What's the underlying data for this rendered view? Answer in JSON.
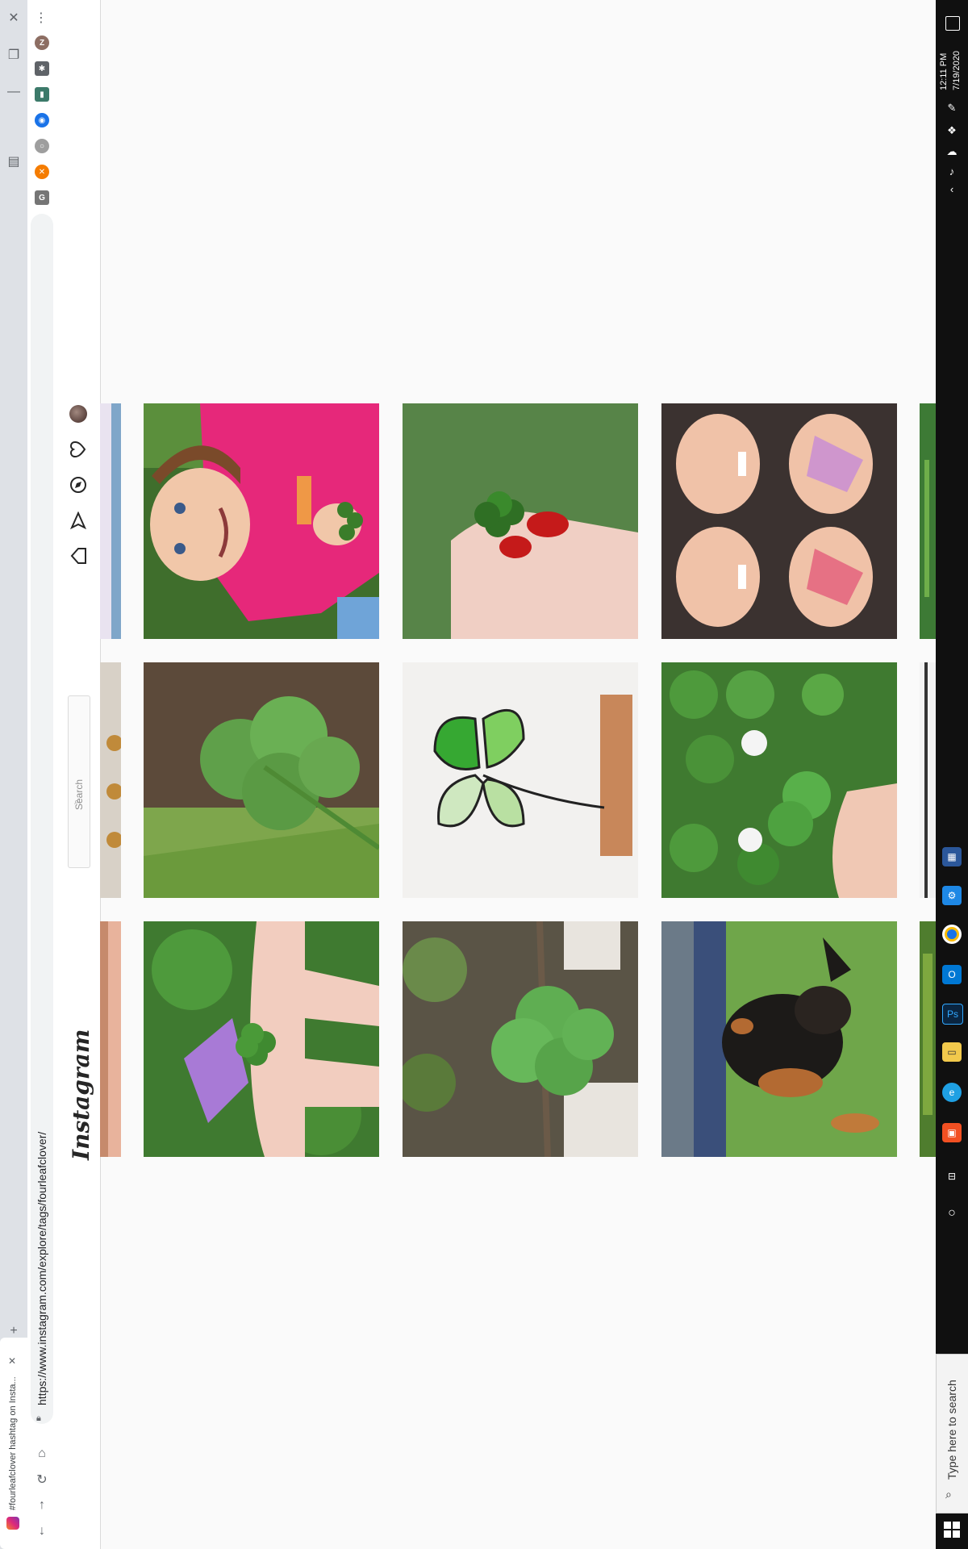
{
  "browser": {
    "tab_title": "#fourleafclover hashtag on Insta...",
    "url": "https://www.instagram.com/explore/tags/fourleafclover/",
    "new_tab_symbol": "+",
    "profile_initial": "Z",
    "menu_symbol": "⋮"
  },
  "instagram": {
    "logo": "Instagram",
    "search_placeholder": "Search"
  },
  "grid": [
    [
      {
        "name": "girl-pink-shirt-holding-clover"
      },
      {
        "name": "red-nails-holding-four-leaf-clover"
      },
      {
        "name": "girls-with-face-paint"
      }
    ],
    [
      {
        "name": "clover-in-grass"
      },
      {
        "name": "stained-glass-clover"
      },
      {
        "name": "hand-with-clover-in-white-clover-field"
      }
    ],
    [
      {
        "name": "fingers-holding-clover-and-flower"
      },
      {
        "name": "clover-among-leaves"
      },
      {
        "name": "dog-on-grass"
      }
    ]
  ],
  "taskbar": {
    "search_placeholder": "Type here to search",
    "time": "12:11 PM",
    "date": "7/19/2020"
  }
}
